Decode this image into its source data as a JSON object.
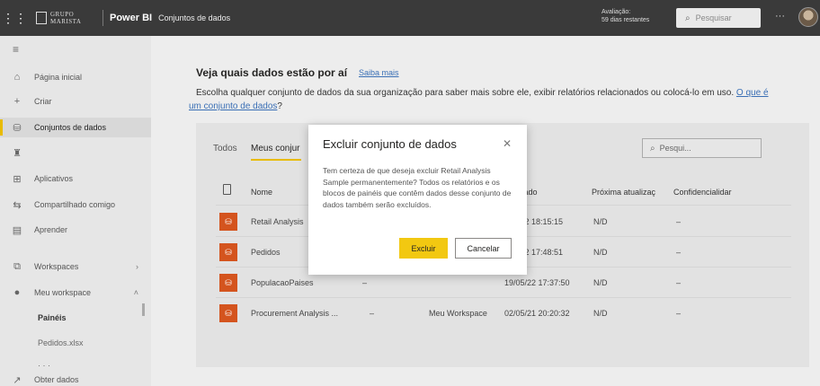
{
  "topbar": {
    "org_line1": "GRUPO",
    "org_line2": "MARISTA",
    "app_name": "Power BI",
    "breadcrumb": "Conjuntos de dados",
    "trial_line1": "Avaliação:",
    "trial_line2": "59 dias restantes",
    "search_placeholder": "Pesquisar",
    "more": "···"
  },
  "sidebar": {
    "items": [
      {
        "label": "Página inicial",
        "icon": "home-icon",
        "glyph": "⌂"
      },
      {
        "label": "Criar",
        "icon": "plus-icon",
        "glyph": "+"
      },
      {
        "label": "Conjuntos de dados",
        "icon": "database-icon",
        "glyph": "⛁"
      },
      {
        "label": "",
        "icon": "trophy-icon",
        "glyph": "♜"
      },
      {
        "label": "Aplicativos",
        "icon": "apps-icon",
        "glyph": "⊞"
      },
      {
        "label": "Compartilhado comigo",
        "icon": "share-icon",
        "glyph": "⇆"
      },
      {
        "label": "Aprender",
        "icon": "book-icon",
        "glyph": "▤"
      },
      {
        "label": "Workspaces",
        "icon": "workspaces-icon",
        "glyph": "⧉"
      },
      {
        "label": "Meu workspace",
        "icon": "user-avatar-icon",
        "glyph": "●"
      },
      {
        "label": "Obter dados",
        "icon": "arrow-up-right-icon",
        "glyph": "↗"
      }
    ],
    "sub_items": [
      "Painéis",
      "Pedidos.xlsx",
      "· · ·"
    ]
  },
  "main": {
    "heading": "Veja quais dados estão por aí",
    "learn_more": "Saiba mais",
    "desc_text": "Escolha qualquer conjunto de dados da sua organização para saber mais sobre ele, exibir relatórios relacionados ou colocá-lo em uso.",
    "desc_link": "O que é um conjunto de dados",
    "desc_end": "?",
    "tabs": [
      "Todos",
      "Meus conjur"
    ],
    "search_placeholder": "Pesqui...",
    "columns": [
      "Nome",
      "izado",
      "Próxima atualizaç",
      "Confidencialidar"
    ],
    "rows": [
      {
        "name": "Retail Analysis",
        "owner": "",
        "workspace": "",
        "updated": "/22 18:15:15",
        "next": "N/D",
        "conf": "–"
      },
      {
        "name": "Pedidos",
        "owner": "",
        "workspace": "",
        "updated": "/22 17:48:51",
        "next": "N/D",
        "conf": "–"
      },
      {
        "name": "PopulacaoPaises",
        "owner": "–",
        "workspace": "",
        "updated": "19/05/22 17:37:50",
        "next": "N/D",
        "conf": "–"
      },
      {
        "name": "Procurement Analysis ...",
        "owner": "–",
        "workspace": "Meu Workspace",
        "updated": "02/05/21 20:20:32",
        "next": "N/D",
        "conf": "–"
      }
    ]
  },
  "dialog": {
    "title": "Excluir conjunto de dados",
    "body": "Tem certeza de que deseja excluir Retail Analysis Sample permanentemente? Todos os relatórios e os blocos de painéis que contêm dados desse conjunto de dados também serão excluídos.",
    "confirm_label": "Excluir",
    "cancel_label": "Cancelar"
  },
  "colors": {
    "accent": "#f2c811",
    "dataset_icon": "#d4541e",
    "link": "#3a6fb5"
  }
}
